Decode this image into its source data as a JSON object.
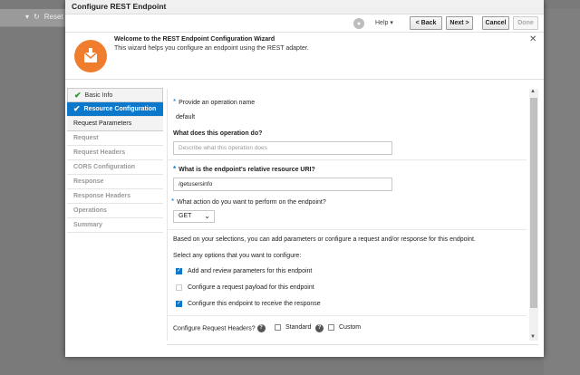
{
  "background": {
    "reset_label": "Reset"
  },
  "dialog": {
    "title": "Configure REST Endpoint",
    "toolbar": {
      "help_label": "Help",
      "back_label": "< Back",
      "next_label": "Next >",
      "cancel_label": "Cancel",
      "done_label": "Done"
    },
    "welcome": {
      "title": "Welcome to the REST Endpoint Configuration Wizard",
      "description": "This wizard helps you configure an endpoint using the REST adapter."
    },
    "nav": {
      "items": [
        {
          "label": "Basic Info",
          "state": "done"
        },
        {
          "label": "Resource Configuration",
          "state": "active"
        },
        {
          "label": "Request Parameters",
          "state": "sub"
        },
        {
          "label": "Request",
          "state": "disabled"
        },
        {
          "label": "Request Headers",
          "state": "disabled"
        },
        {
          "label": "CORS Configuration",
          "state": "disabled"
        },
        {
          "label": "Response",
          "state": "disabled"
        },
        {
          "label": "Response Headers",
          "state": "disabled"
        },
        {
          "label": "Operations",
          "state": "disabled"
        },
        {
          "label": "Summary",
          "state": "disabled"
        }
      ]
    },
    "form": {
      "op_name_label": "Provide an operation name",
      "op_name_value": "default",
      "op_desc_label": "What does this operation do?",
      "op_desc_placeholder": "Describe what this operation does",
      "uri_label": "What is the endpoint's relative resource URI?",
      "uri_value": "/getusersinfo",
      "action_label": "What action do you want to perform on the endpoint?",
      "action_value": "GET",
      "info_text": "Based on your selections, you can add parameters or configure a request and/or response for this endpoint.",
      "options_label": "Select any options that you want to configure:",
      "options": [
        {
          "label": "Add and review parameters for this endpoint",
          "checked": true
        },
        {
          "label": "Configure a request payload for this endpoint",
          "checked": false
        },
        {
          "label": "Configure this endpoint to receive the response",
          "checked": true
        }
      ],
      "req_headers_label": "Configure Request Headers?",
      "standard_label": "Standard",
      "custom_label": "Custom"
    }
  }
}
